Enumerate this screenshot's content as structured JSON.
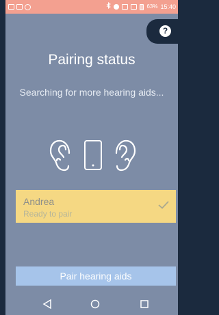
{
  "status_bar": {
    "battery": "63%",
    "time": "15:40"
  },
  "help": {
    "glyph": "?"
  },
  "title": "Pairing status",
  "subtitle": "Searching for more hearing aids...",
  "device": {
    "name": "Andrea",
    "status": "Ready to pair"
  },
  "pair_button": {
    "label": "Pair hearing aids"
  },
  "icons": [
    "left-ear-icon",
    "phone-icon",
    "right-ear-icon",
    "checkmark-icon",
    "help-icon",
    "back-nav-icon",
    "home-nav-icon",
    "recents-nav-icon"
  ],
  "colors": {
    "background": "#7d8ca6",
    "status_bar": "#f3a090",
    "device_row": "#f5d883",
    "button": "#a6c4ea",
    "help_button": "#1b2a3e"
  }
}
